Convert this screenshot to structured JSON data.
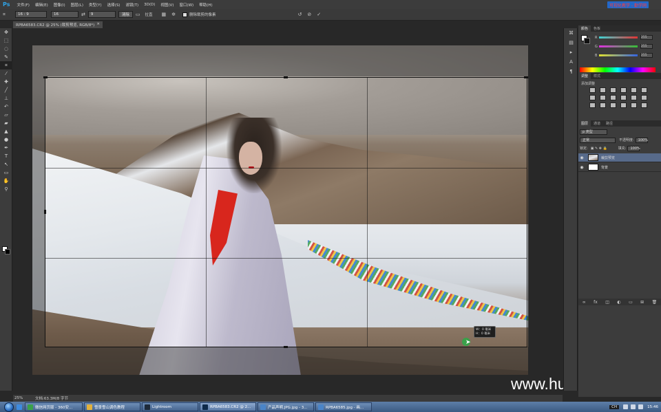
{
  "menubar": {
    "logo": "Ps",
    "items": [
      "文件(F)",
      "编辑(E)",
      "图像(I)",
      "图层(L)",
      "类型(Y)",
      "选择(S)",
      "滤镜(T)",
      "3D(D)",
      "视图(V)",
      "窗口(W)",
      "帮助(H)"
    ],
    "badge": "可视化教学 - 勤学网"
  },
  "options_bar": {
    "ratio": "16 : 9",
    "width_value": "16",
    "height_value": "9",
    "clear_button": "清除",
    "straighten_label": "拉直",
    "delete_cropped_label": "删除裁剪的像素"
  },
  "document": {
    "tab_title": "RPBA6583.CR2 @ 25% (裁剪预览, RGB/8*)",
    "tab_close": "×"
  },
  "canvas": {
    "tooltip_line1": "W：0 毫米",
    "tooltip_line2": "H：0 毫米",
    "watermark": "www.hunls.com"
  },
  "status_bar": {
    "zoom": "25%",
    "doc_info": "文档:63.3M/8 字节"
  },
  "panels": {
    "color_tabs": [
      "颜色",
      "色板"
    ],
    "color_sliders": [
      {
        "label": "R",
        "value": "255",
        "color": "#e23434"
      },
      {
        "label": "G",
        "value": "255",
        "color": "#34c034"
      },
      {
        "label": "B",
        "value": "255",
        "color": "#3464e2"
      }
    ],
    "adjust_tabs": [
      "调整",
      "样式"
    ],
    "adjust_label": "添加调整",
    "layers_tabs": [
      "图层",
      "通道",
      "路径"
    ],
    "kind_filter": "p 类型",
    "blend_mode": "正常",
    "opacity_label": "不透明度:",
    "opacity_value": "100%",
    "lock_label": "锁定:",
    "fill_label": "填充:",
    "fill_value": "100%",
    "layers": [
      {
        "name": "裁剪预览",
        "selected": true
      },
      {
        "name": "背景",
        "selected": false
      }
    ]
  },
  "taskbar": {
    "items": [
      {
        "label": "微信网页版 - 360安...",
        "color": "#3aa14a"
      },
      {
        "label": "雪景雪山调色教程",
        "color": "#e2b13c"
      },
      {
        "label": "Lightroom",
        "color": "#1e2a3a"
      },
      {
        "label": "RPBA6583.CR2 @ 2...",
        "color": "#0e2a4a"
      },
      {
        "label": "产品声明.JPG.jpg - 3...",
        "color": "#4a84c8"
      },
      {
        "label": "RPBA6585.jpg - 画...",
        "color": "#4a84c8"
      }
    ],
    "ime": "CH",
    "clock": "15:46"
  }
}
